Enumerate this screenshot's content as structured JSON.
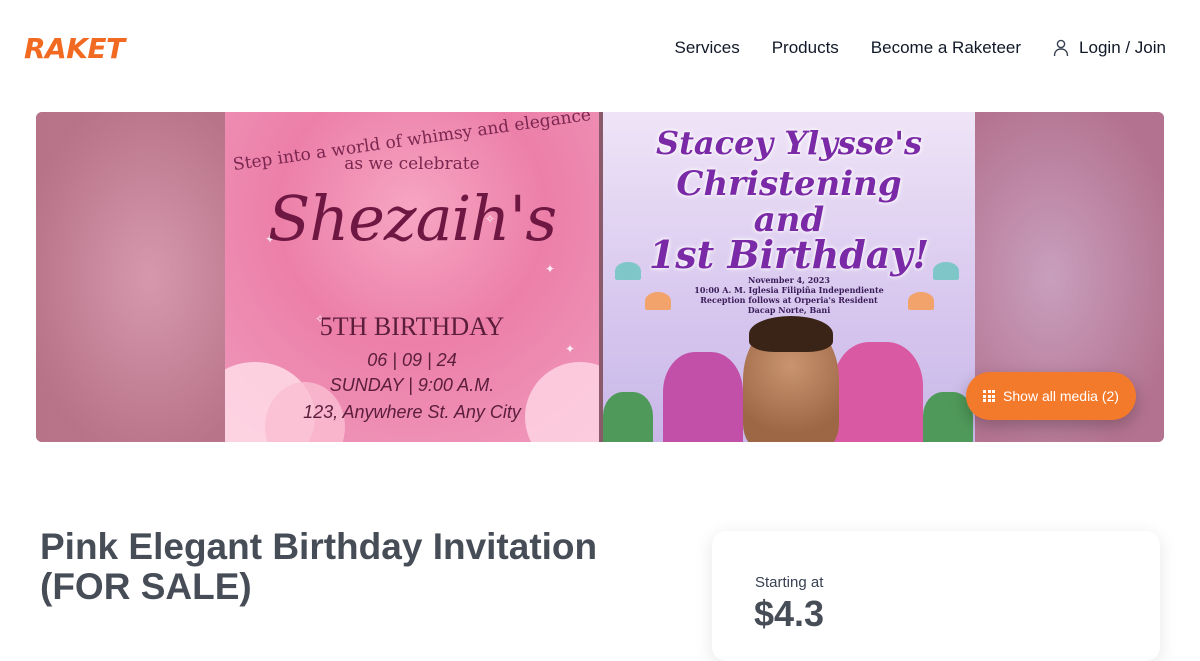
{
  "brand": {
    "logo_text": "RAKET",
    "accent": "#f26a21"
  },
  "nav": {
    "items": [
      {
        "label": "Services"
      },
      {
        "label": "Products"
      },
      {
        "label": "Become a Raketeer"
      }
    ],
    "login_label": "Login / Join",
    "login_icon": "user-icon"
  },
  "gallery": {
    "images": [
      {
        "tagline_1": "Step into a world of whimsy and elegance",
        "tagline_2": "as we celebrate",
        "name": "Shezaih's",
        "event": "5TH BIRTHDAY",
        "date": "06 | 09 | 24",
        "time": "SUNDAY  |  9:00 A.M.",
        "address": "123, Anywhere St. Any City"
      },
      {
        "line_1": "Stacey Ylysse's",
        "line_2": "Christening",
        "line_3": "and",
        "line_4": "1st Birthday!",
        "detail_1": "November 4, 2023",
        "detail_2": "10:00 A. M.  Iglesia Filipiña Independiente",
        "detail_3": "Reception follows at Orperia's Resident",
        "detail_4": "Dacap Norte, Bani"
      }
    ],
    "show_media_label": "Show all media (2)",
    "show_media_icon": "grid-icon"
  },
  "listing": {
    "title_line_1": "Pink Elegant Birthday Invitation",
    "title_line_2": "(FOR SALE)",
    "price_label": "Starting at",
    "price_value": "$4.3"
  }
}
